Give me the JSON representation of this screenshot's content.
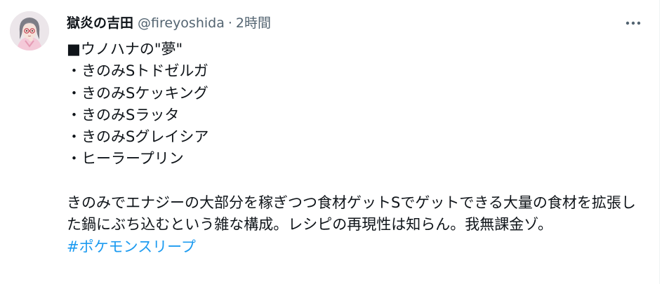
{
  "tweet": {
    "display_name": "獄炎の吉田",
    "handle": "@fireyoshida",
    "separator": "·",
    "time": "2時間",
    "lines": [
      "■ウノハナの\"夢\"",
      "・きのみSトドゼルガ",
      "・きのみSケッキング",
      "・きのみSラッタ",
      "・きのみSグレイシア",
      "・ヒーラープリン"
    ],
    "paragraph": "きのみでエナジーの大部分を稼ぎつつ食材ゲットSでゲットできる大量の食材を拡張した鍋にぶち込むという雑な構成。レシピの再現性は知らん。我無課金ゾ。",
    "hashtag": "#ポケモンスリープ",
    "icons": {
      "more": "more-horizontal-icon",
      "avatar": "user-avatar"
    },
    "colors": {
      "text": "#0f1419",
      "secondary": "#536471",
      "link": "#1d9bf0"
    }
  }
}
